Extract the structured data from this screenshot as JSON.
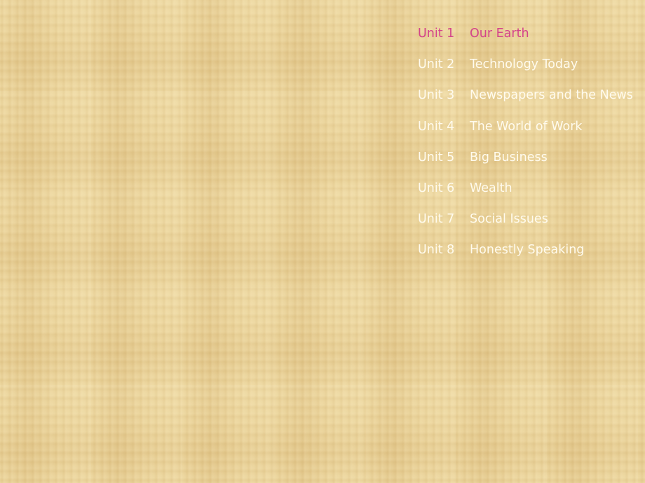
{
  "units": [
    {
      "unit": "Unit 1",
      "title": "Our Earth",
      "active": true
    },
    {
      "unit": "Unit 2",
      "title": "Technology Today"
    },
    {
      "unit": "Unit 3",
      "title": "Newspapers and the News"
    },
    {
      "unit": "Unit 4",
      "title": "The World of Work"
    },
    {
      "unit": "Unit 5",
      "title": "Big Business"
    },
    {
      "unit": "Unit 6",
      "title": "Wealth"
    },
    {
      "unit": "Unit 7",
      "title": "Social Issues"
    },
    {
      "unit": "Unit 8",
      "title": "Honestly Speaking"
    }
  ],
  "colors": {
    "active": "#d4448a",
    "text": "#fffbee",
    "background": "#ecd69e"
  }
}
